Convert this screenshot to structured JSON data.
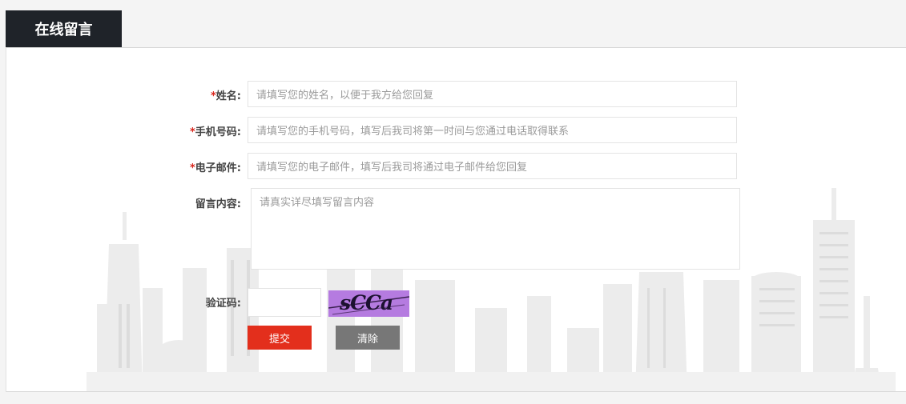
{
  "tab": {
    "title": "在线留言"
  },
  "form": {
    "required_mark": "*",
    "name": {
      "label": "姓名:",
      "placeholder": "请填写您的姓名，以便于我方给您回复"
    },
    "phone": {
      "label": "手机号码:",
      "placeholder": "请填写您的手机号码，填写后我司将第一时间与您通过电话取得联系"
    },
    "email": {
      "label": "电子邮件:",
      "placeholder": "请填写您的电子邮件，填写后我司将通过电子邮件给您回复"
    },
    "message": {
      "label": "留言内容:",
      "placeholder": "请真实详尽填写留言内容"
    },
    "captcha": {
      "label": "验证码:",
      "image_text": "sCCa"
    },
    "buttons": {
      "submit": "提交",
      "clear": "清除"
    }
  },
  "colors": {
    "tab_bg": "#1f2329",
    "required": "#d9261c",
    "submit_bg": "#e32f1c",
    "clear_bg": "#777777",
    "captcha_bg": "#b57be0"
  }
}
